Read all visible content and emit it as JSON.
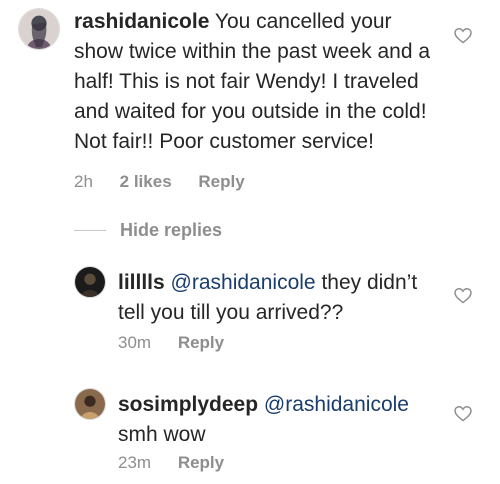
{
  "comments": [
    {
      "username": "rashidanicole",
      "text": "You cancelled your show twice within the past week and a half! This is not fair Wendy! I traveled and waited for you outside in the cold! Not fair!! Poor customer service!",
      "time": "2h",
      "likes": "2 likes",
      "reply": "Reply",
      "avatar_icon": "profile-photo"
    }
  ],
  "hide_replies": "Hide replies",
  "replies": [
    {
      "username": "lilllls",
      "mention": "@rashidanicole",
      "text": "they didn’t tell you till you arrived??",
      "time": "30m",
      "reply": "Reply",
      "avatar_icon": "profile-photo"
    },
    {
      "username": "sosimplydeep",
      "mention": "@rashidanicole",
      "text": "smh wow",
      "time": "23m",
      "reply": "Reply",
      "avatar_icon": "profile-photo"
    }
  ],
  "icons": {
    "like": "heart-outline-icon"
  },
  "colors": {
    "text": "#262626",
    "muted": "#8e8e8e",
    "mention": "#1a3d6e"
  }
}
